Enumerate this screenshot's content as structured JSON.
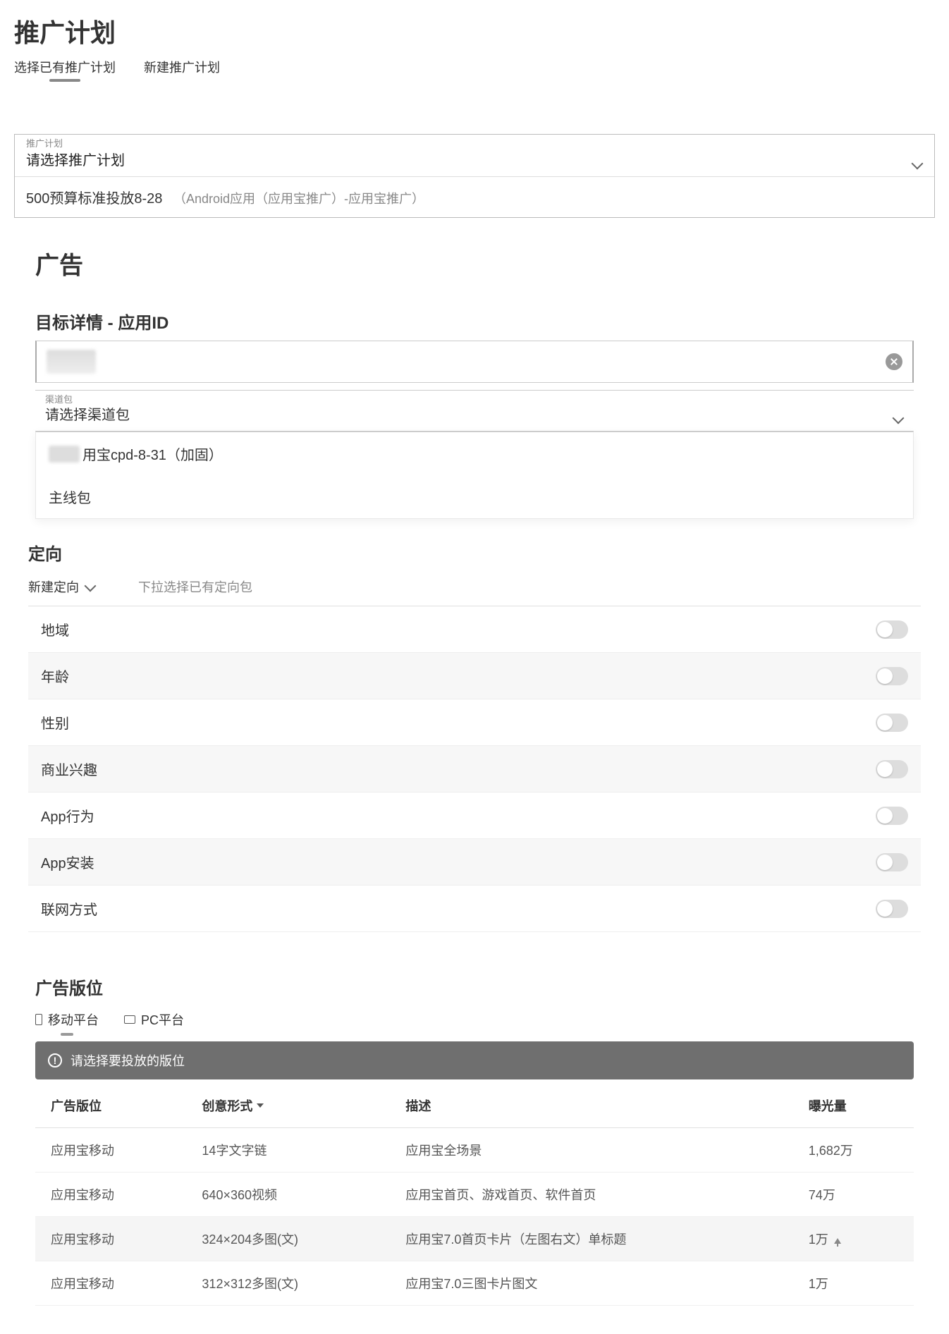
{
  "header": {
    "title": "推广计划",
    "tabs": [
      "选择已有推广计划",
      "新建推广计划"
    ]
  },
  "planSelect": {
    "label": "推广计划",
    "value": "请选择推广计划",
    "option_name": "500预算标准投放8-28",
    "option_meta": "（Android应用（应用宝推广）-应用宝推广）"
  },
  "ad": {
    "title": "广告",
    "target_title": "目标详情 - 应用ID",
    "channel_label": "渠道包",
    "channel_value": "请选择渠道包",
    "channel_options": [
      "用宝cpd-8-31（加固）",
      "主线包"
    ]
  },
  "targeting": {
    "title": "定向",
    "new_label": "新建定向",
    "hint": "下拉选择已有定向包",
    "rows": [
      "地域",
      "年龄",
      "性别",
      "商业兴趣",
      "App行为",
      "App安装",
      "联网方式"
    ]
  },
  "placements": {
    "title": "广告版位",
    "platforms": [
      "移动平台",
      "PC平台"
    ],
    "banner": "请选择要投放的版位",
    "columns": [
      "广告版位",
      "创意形式",
      "描述",
      "曝光量"
    ],
    "rows": [
      {
        "slot": "应用宝移动",
        "creative": "14字文字链",
        "desc": "应用宝全场景",
        "exposure": "1,682万"
      },
      {
        "slot": "应用宝移动",
        "creative": "640×360视频",
        "desc": "应用宝首页、游戏首页、软件首页",
        "exposure": "74万"
      },
      {
        "slot": "应用宝移动",
        "creative": "324×204多图(文)",
        "desc": "应用宝7.0首页卡片（左图右文）单标题",
        "exposure": "1万"
      },
      {
        "slot": "应用宝移动",
        "creative": "312×312多图(文)",
        "desc": "应用宝7.0三图卡片图文",
        "exposure": "1万"
      }
    ]
  }
}
